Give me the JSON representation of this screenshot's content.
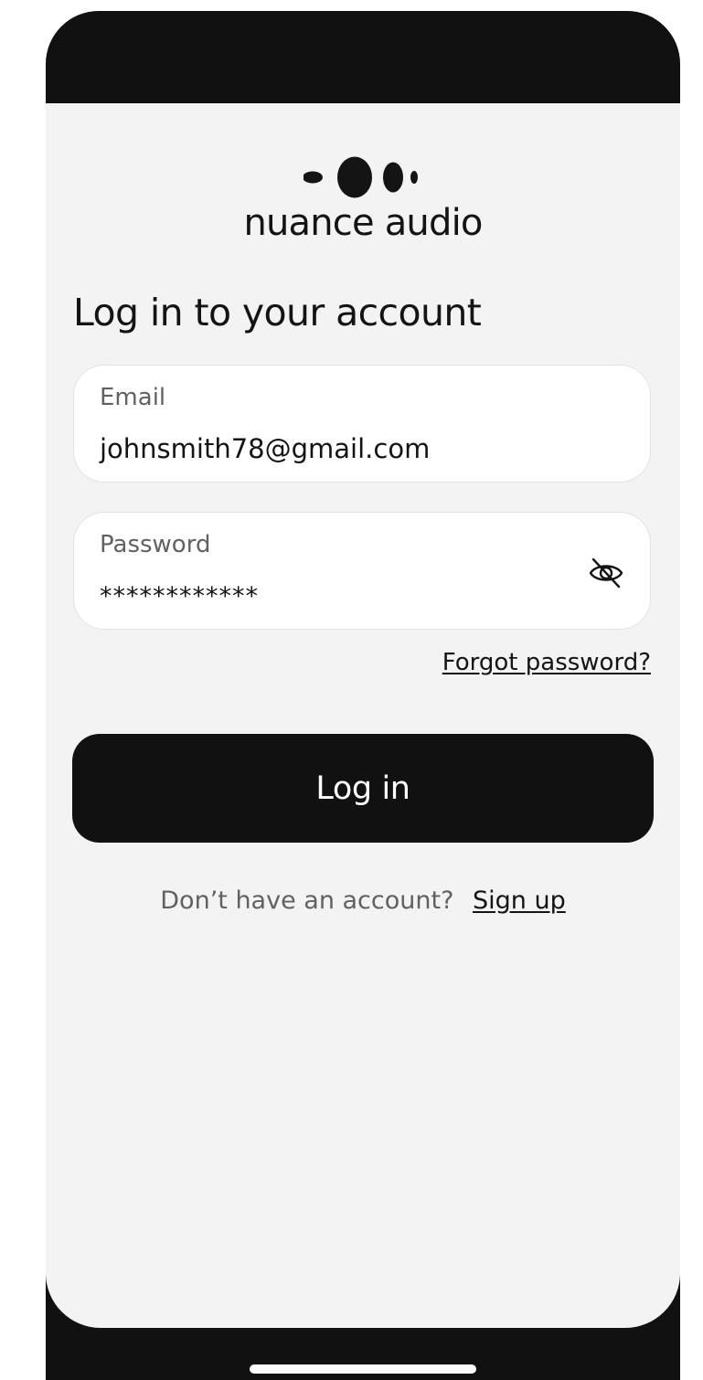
{
  "brand": {
    "name": "nuance audio",
    "logo_icon": "four-dots-logo-icon"
  },
  "login": {
    "title": "Log in to your account",
    "email": {
      "label": "Email",
      "value": "johnsmith78@gmail.com"
    },
    "password": {
      "label": "Password",
      "value": "************",
      "toggle_icon": "eye-slash-icon"
    },
    "forgot_password": "Forgot password?",
    "submit_label": "Log in",
    "signup_prompt": "Don’t have an account?",
    "signup_link": "Sign up"
  },
  "colors": {
    "background": "#f3f3f3",
    "device_frame": "#111111",
    "primary_button": "#111111",
    "field_background": "#ffffff",
    "muted_text": "#616161"
  }
}
